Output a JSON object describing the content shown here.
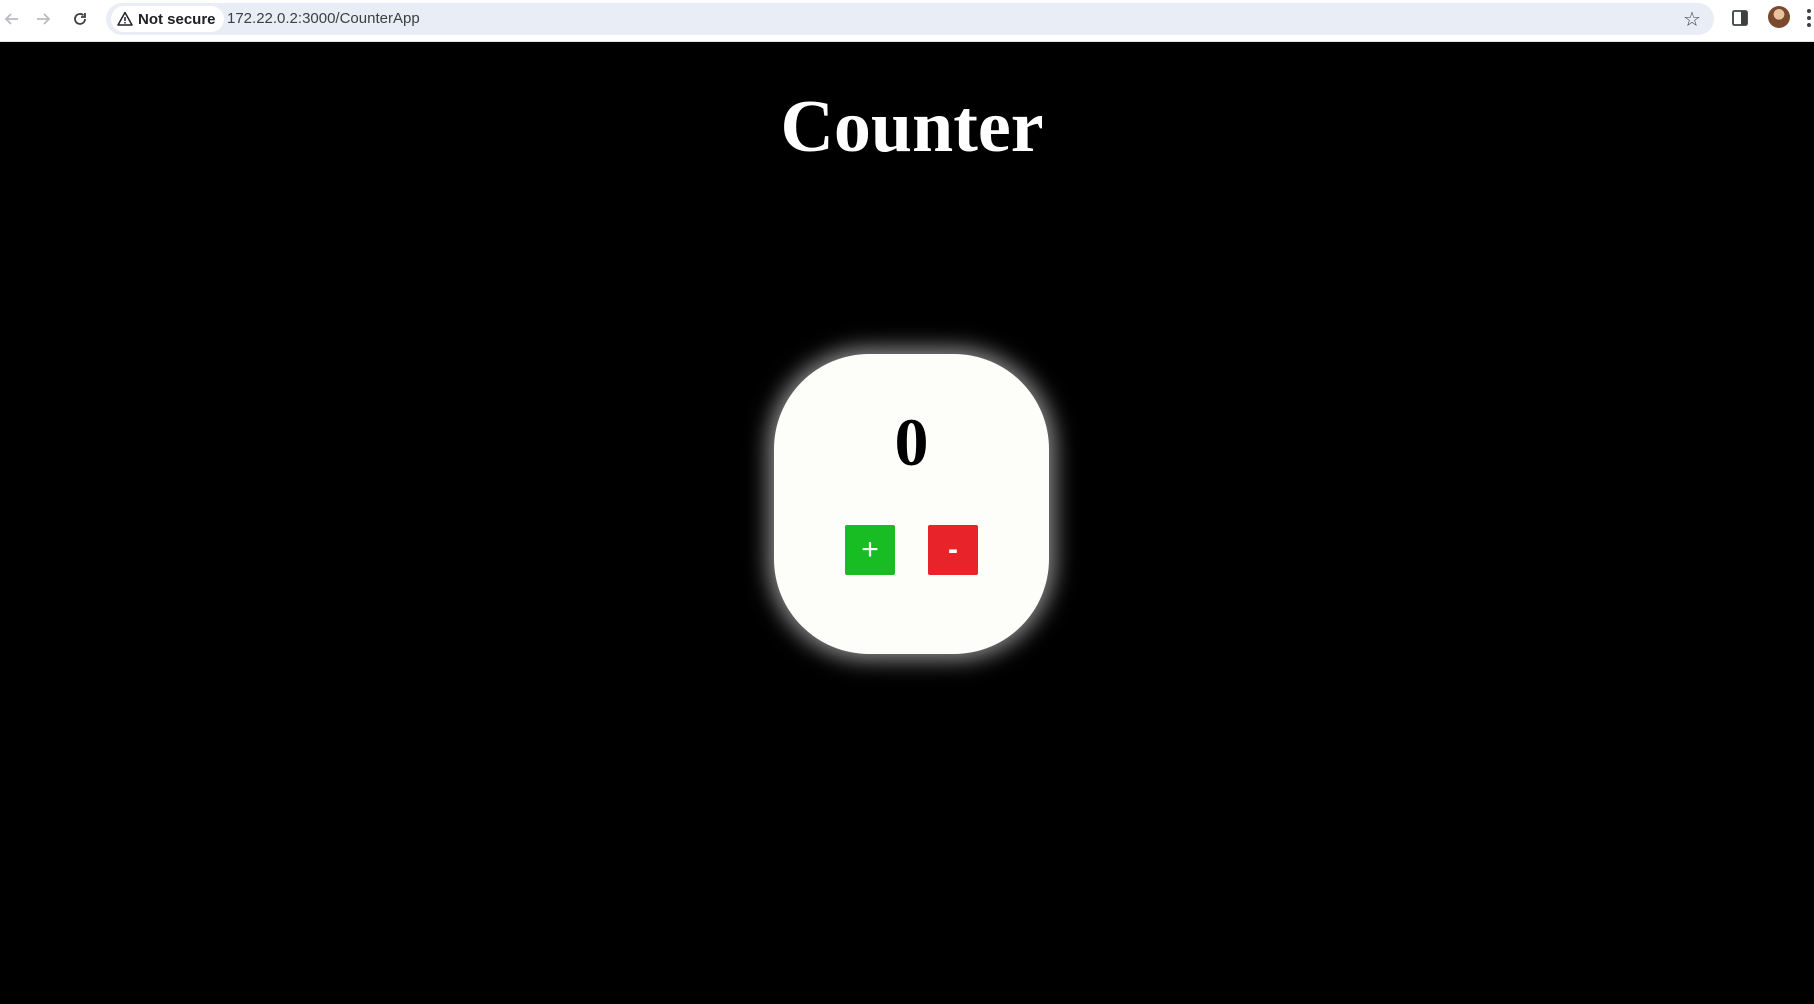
{
  "browser": {
    "security_label": "Not secure",
    "url": "172.22.0.2:3000/CounterApp",
    "icons": [
      "back-icon",
      "forward-icon",
      "reload-icon",
      "warning-icon",
      "star-icon",
      "side-panel-icon",
      "avatar",
      "menu-icon"
    ]
  },
  "page": {
    "title": "Counter",
    "count": "0",
    "increment_label": "+",
    "decrement_label": "-"
  },
  "colors": {
    "background": "#000000",
    "card": "#fdfdf9",
    "increment": "#18bd24",
    "decrement": "#e8242a"
  }
}
